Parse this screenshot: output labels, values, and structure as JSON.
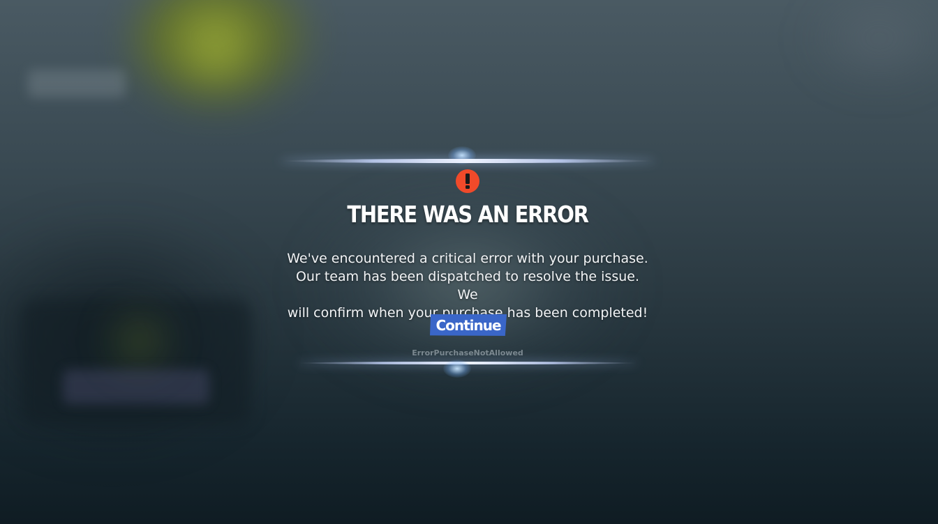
{
  "dialog": {
    "title": "THERE WAS AN ERROR",
    "message": "We've encountered a critical error with your purchase.\nOur team has been dispatched to resolve the issue. We\nwill confirm when your purchase has been completed!",
    "continue_label": "Continue",
    "error_code": "ErrorPurchaseNotAllowed",
    "icon": "exclamation-icon"
  },
  "colors": {
    "error_icon": "#f04a2a",
    "button": "#3a66c8",
    "text": "#ffffff"
  }
}
